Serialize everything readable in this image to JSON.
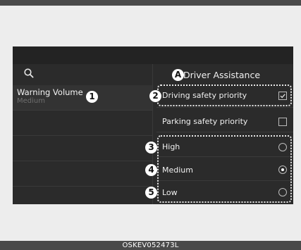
{
  "caption": "OSKEV052473L",
  "left_menu": {
    "item_label": "Warning Volume",
    "item_value": "Medium"
  },
  "section": {
    "title": "Driver Assistance"
  },
  "options": {
    "driving_safety": {
      "label": "Driving safety priority",
      "checked": true
    },
    "parking_safety": {
      "label": "Parking safety priority",
      "checked": false
    }
  },
  "volume_levels": [
    {
      "label": "High",
      "selected": false
    },
    {
      "label": "Medium",
      "selected": true
    },
    {
      "label": "Low",
      "selected": false
    }
  ],
  "callouts": {
    "a": "A",
    "n1": "1",
    "n2": "2",
    "n3": "3",
    "n4": "4",
    "n5": "5"
  },
  "icons": {
    "search": "search-icon",
    "check": "checkmark-icon"
  },
  "colors": {
    "screen_bg": "#2b2b2b",
    "page_bg": "#ededed",
    "bar": "#4a4a4a",
    "text": "#f0f0f0",
    "subtext": "#6f6f6f"
  }
}
